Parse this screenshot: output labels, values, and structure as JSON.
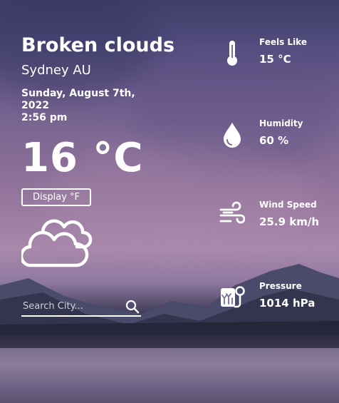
{
  "weather": {
    "condition": "Broken clouds",
    "location": "Sydney AU",
    "date": "Sunday, August 7th, 2022",
    "time": "2:56 pm",
    "temperature": "16 °C",
    "unit_toggle_label": "Display °F",
    "icon": "broken-clouds-icon"
  },
  "search": {
    "placeholder": "Search City...",
    "icon": "search-icon"
  },
  "stats": [
    {
      "label": "Feels Like",
      "value": "15 °C",
      "icon": "thermometer-icon"
    },
    {
      "label": "Humidity",
      "value": "60 %",
      "icon": "droplet-icon"
    },
    {
      "label": "Wind Speed",
      "value": "25.9 km/h",
      "icon": "wind-icon"
    },
    {
      "label": "Pressure",
      "value": "1014 hPa",
      "icon": "pressure-icon"
    }
  ],
  "colors": {
    "text": "#ffffff",
    "sky_top": "#3f3e69",
    "sky_bottom": "#a888ab"
  }
}
